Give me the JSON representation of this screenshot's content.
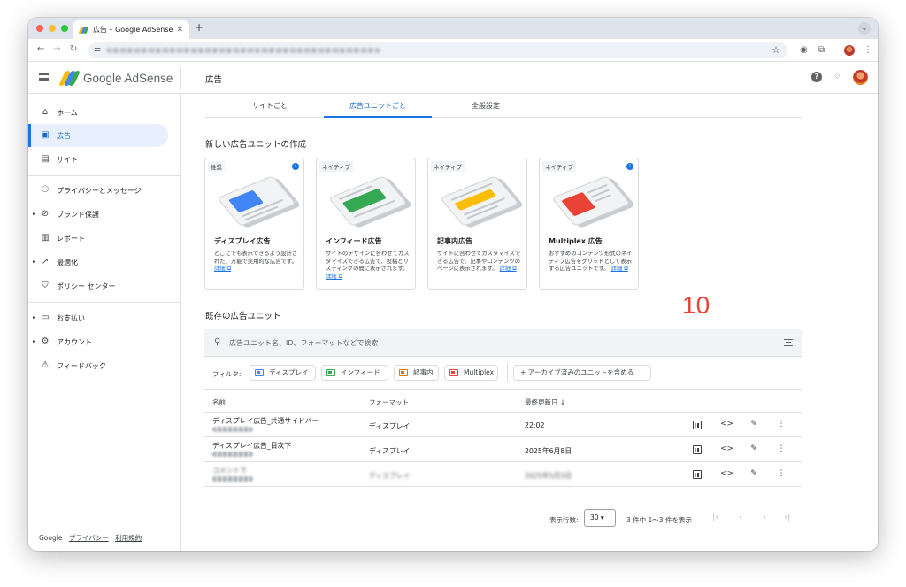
{
  "browser": {
    "tab_title": "広告 – Google AdSense",
    "tab_close": "✕",
    "new_tab": "+",
    "tab_menu": "⌄",
    "nav": {
      "back": "←",
      "forward": "→",
      "reload": "↻"
    },
    "star": "☆"
  },
  "header": {
    "brand": "Google AdSense",
    "page_title": "広告",
    "help": "?",
    "bell": "🔔︎"
  },
  "sidebar": {
    "items": [
      {
        "label": "ホーム",
        "icon": "home-icon",
        "glyph": "⌂",
        "caret": ""
      },
      {
        "label": "広告",
        "icon": "ads-icon",
        "glyph": "▣",
        "caret": "",
        "active": true
      },
      {
        "label": "サイト",
        "icon": "sites-icon",
        "glyph": "▤",
        "caret": ""
      },
      {
        "label": "プライバシーとメッセージ",
        "icon": "privacy-icon",
        "glyph": "⚇",
        "caret": ""
      },
      {
        "label": "ブランド保護",
        "icon": "block-icon",
        "glyph": "⊘",
        "caret": "▸"
      },
      {
        "label": "レポート",
        "icon": "report-icon",
        "glyph": "▥",
        "caret": ""
      },
      {
        "label": "最適化",
        "icon": "trend-icon",
        "glyph": "↗",
        "caret": "▸"
      },
      {
        "label": "ポリシー センター",
        "icon": "policy-icon",
        "glyph": "⛉",
        "caret": ""
      },
      {
        "label": "お支払い",
        "icon": "payments-icon",
        "glyph": "▭",
        "caret": "▸"
      },
      {
        "label": "アカウント",
        "icon": "settings-icon",
        "glyph": "⚙",
        "caret": "▸"
      },
      {
        "label": "フィードバック",
        "icon": "feedback-icon",
        "glyph": "⚠",
        "caret": ""
      }
    ],
    "footer": {
      "google": "Google",
      "privacy": "プライバシー",
      "terms": "利用規約"
    }
  },
  "tabs": [
    {
      "label": "サイトごと"
    },
    {
      "label": "広告ユニットごと",
      "active": true
    },
    {
      "label": "全般設定"
    }
  ],
  "create_section": {
    "title": "新しい広告ユニットの作成",
    "cards": [
      {
        "tag": "推奨",
        "title": "ディスプレイ広告",
        "desc": "どこにでも表示できるよう設計された、万能で実用的な広告です。",
        "link": "詳細 ⧉",
        "color": "#4285f4",
        "badge": "i"
      },
      {
        "tag": "ネイティブ",
        "title": "インフィード広告",
        "desc": "サイトのデザインに合わせてカスタマイズできる広告で、投稿とリスティングの間に表示されます。",
        "link": "詳細 ⧉",
        "color": "#34a853",
        "badge": ""
      },
      {
        "tag": "ネイティブ",
        "title": "記事内広告",
        "desc": "サイトに合わせてカスタマイズできる広告で、記事やコンテンツのページに表示されます。",
        "link": "詳細 ⧉",
        "color": "#fbbc04",
        "badge": ""
      },
      {
        "tag": "ネイティブ",
        "title": "Multiplex 広告",
        "desc": "おすすめのコンテンツ形式のネイティブ広告をグリッドとして表示する広告ユニットです。",
        "link": "詳細 ⧉",
        "color": "#ea4335",
        "badge": "i"
      }
    ]
  },
  "annotation": "10",
  "existing_section": {
    "title": "既存の広告ユニット",
    "search_placeholder": "広告ユニット名、ID、フォーマットなどで検索",
    "filter_label": "フィルタ:",
    "chips": [
      {
        "label": "ディスプレイ",
        "color": "#4285f4"
      },
      {
        "label": "インフィード",
        "color": "#34a853"
      },
      {
        "label": "記事内",
        "color": "#e37400"
      },
      {
        "label": "Multiplex",
        "color": "#ea4335"
      }
    ],
    "archive_chip": "+ アーカイブ済みのユニットを含める",
    "columns": {
      "name": "名前",
      "format": "フォーマット",
      "updated": "最終更新日 ↓"
    },
    "rows": [
      {
        "name": "ディスプレイ広告_共通サイドバー",
        "format": "ディスプレイ",
        "updated": "22:02",
        "blurred": false
      },
      {
        "name": "ディスプレイ広告_目次下",
        "format": "ディスプレイ",
        "updated": "2025年6月8日",
        "blurred": false
      },
      {
        "name": "コメント下",
        "format": "ディスプレイ",
        "updated": "2025年5月3日",
        "blurred": true
      }
    ],
    "row_actions": {
      "code": "<>",
      "edit": "✎",
      "more": "⋮"
    },
    "pagination": {
      "rows_label": "表示行数:",
      "rows_value": "30 ▾",
      "range": "3 件中 1〜3 件を表示",
      "first": "|‹",
      "prev": "‹",
      "next": "›",
      "last": "›|"
    }
  }
}
